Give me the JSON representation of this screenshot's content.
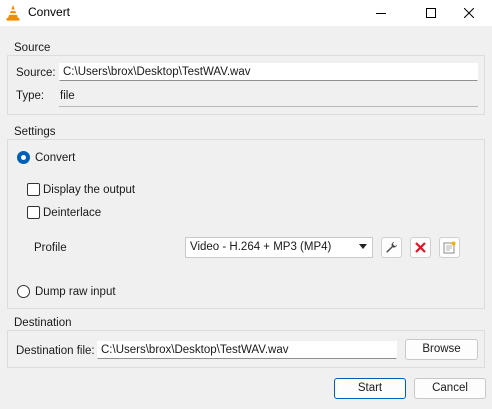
{
  "window": {
    "title": "Convert",
    "icon": "vlc-cone-icon",
    "controls": [
      "minimize-icon",
      "maximize-icon",
      "close-icon"
    ]
  },
  "source": {
    "group_title": "Source",
    "source_label": "Source:",
    "source_value": "C:\\Users\\brox\\Desktop\\TestWAV.wav",
    "type_label": "Type:",
    "type_value": "file"
  },
  "settings": {
    "group_title": "Settings",
    "convert_label": "Convert",
    "convert_selected": true,
    "display_output_label": "Display the output",
    "display_output_checked": false,
    "deinterlace_label": "Deinterlace",
    "deinterlace_checked": false,
    "profile_label": "Profile",
    "profile_value": "Video - H.264 + MP3 (MP4)",
    "profile_tools": [
      "wrench-icon",
      "delete-x-icon",
      "new-profile-icon"
    ],
    "dump_raw_label": "Dump raw input",
    "dump_raw_selected": false
  },
  "destination": {
    "group_title": "Destination",
    "file_label": "Destination file:",
    "file_value": "C:\\Users\\brox\\Desktop\\TestWAV.wav",
    "browse_label": "Browse"
  },
  "footer": {
    "start_label": "Start",
    "cancel_label": "Cancel"
  },
  "colors": {
    "accent": "#005fb8",
    "delete_red": "#e81123",
    "vlc_orange": "#f48b00"
  }
}
